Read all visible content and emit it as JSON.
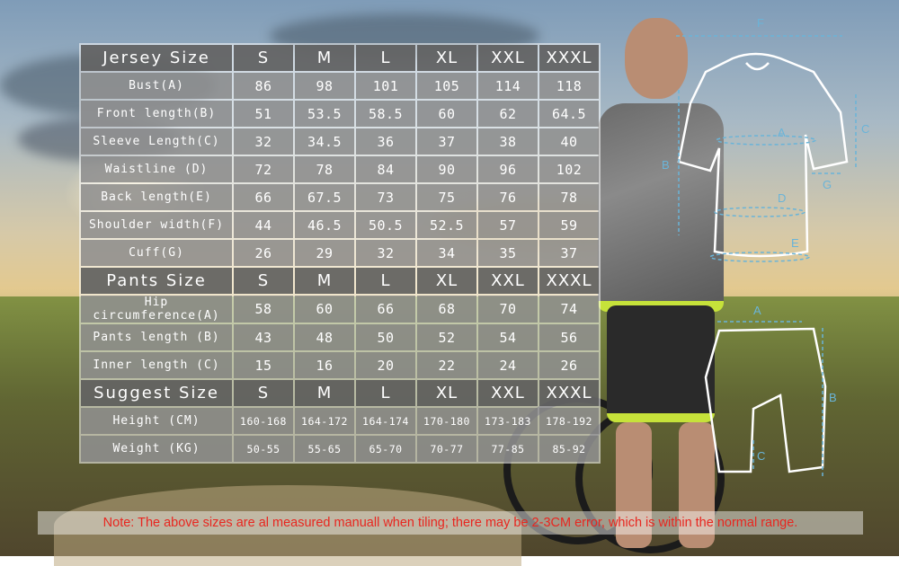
{
  "jersey": {
    "header": [
      "Jersey Size",
      "S",
      "M",
      "L",
      "XL",
      "XXL",
      "XXXL"
    ],
    "rows": [
      [
        "Bust(A)",
        "86",
        "98",
        "101",
        "105",
        "114",
        "118"
      ],
      [
        "Front length(B)",
        "51",
        "53.5",
        "58.5",
        "60",
        "62",
        "64.5"
      ],
      [
        "Sleeve Length(C)",
        "32",
        "34.5",
        "36",
        "37",
        "38",
        "40"
      ],
      [
        "Waistline (D)",
        "72",
        "78",
        "84",
        "90",
        "96",
        "102"
      ],
      [
        "Back length(E)",
        "66",
        "67.5",
        "73",
        "75",
        "76",
        "78"
      ],
      [
        "Shoulder width(F)",
        "44",
        "46.5",
        "50.5",
        "52.5",
        "57",
        "59"
      ],
      [
        "Cuff(G)",
        "26",
        "29",
        "32",
        "34",
        "35",
        "37"
      ]
    ]
  },
  "pants": {
    "header": [
      "Pants Size",
      "S",
      "M",
      "L",
      "XL",
      "XXL",
      "XXXL"
    ],
    "rows": [
      [
        "Hip circumference(A)",
        "58",
        "60",
        "66",
        "68",
        "70",
        "74"
      ],
      [
        "Pants length (B)",
        "43",
        "48",
        "50",
        "52",
        "54",
        "56"
      ],
      [
        "Inner length (C)",
        "15",
        "16",
        "20",
        "22",
        "24",
        "26"
      ]
    ]
  },
  "suggest": {
    "header": [
      "Suggest Size",
      "S",
      "M",
      "L",
      "XL",
      "XXL",
      "XXXL"
    ],
    "rows": [
      [
        "Height (CM)",
        "160-168",
        "164-172",
        "164-174",
        "170-180",
        "173-183",
        "178-192"
      ],
      [
        "Weight (KG)",
        "50-55",
        "55-65",
        "65-70",
        "70-77",
        "77-85",
        "85-92"
      ]
    ]
  },
  "diagram": {
    "jersey_labels": {
      "a": "A",
      "b": "B",
      "c": "C",
      "d": "D",
      "e": "E",
      "f": "F",
      "g": "G"
    },
    "pants_labels": {
      "a": "A",
      "b": "B",
      "c": "C"
    }
  },
  "note": "Note: The above sizes are al measured manuall when tiling; there may be 2-3CM error, which is within the normal range.",
  "colors": {
    "note": "#e8261f",
    "diagram": "#6ab4d8",
    "cell": "#7a7a7a"
  }
}
